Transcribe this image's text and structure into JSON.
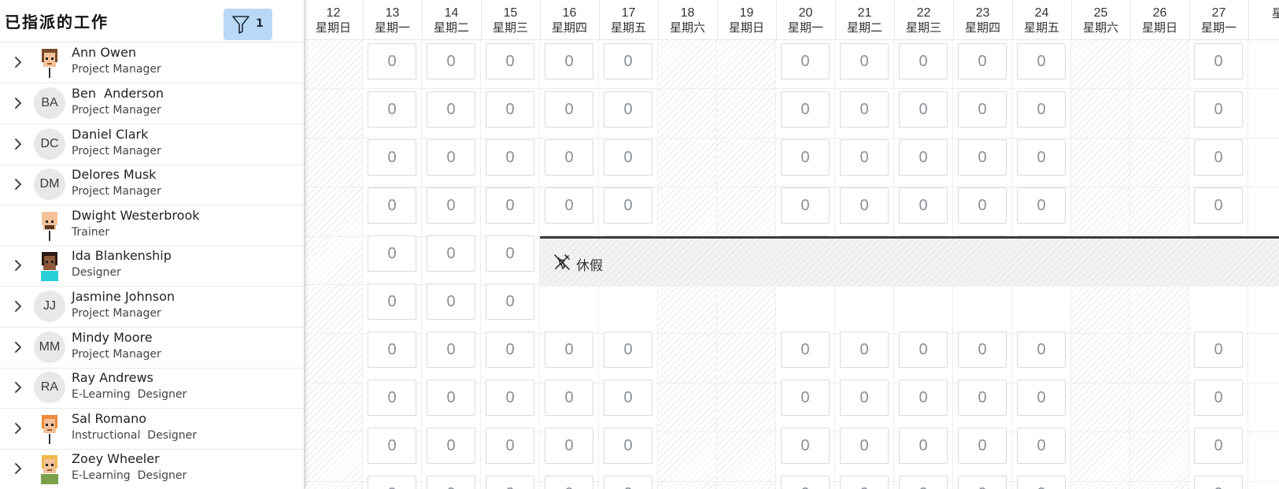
{
  "header": {
    "title": "已指派的工作",
    "filter_count": "1"
  },
  "dates": [
    {
      "num": "12",
      "day": "星期日",
      "weekend": true
    },
    {
      "num": "13",
      "day": "星期一",
      "weekend": false
    },
    {
      "num": "14",
      "day": "星期二",
      "weekend": false
    },
    {
      "num": "15",
      "day": "星期三",
      "weekend": false
    },
    {
      "num": "16",
      "day": "星期四",
      "weekend": false
    },
    {
      "num": "17",
      "day": "星期五",
      "weekend": false
    },
    {
      "num": "18",
      "day": "星期六",
      "weekend": true
    },
    {
      "num": "19",
      "day": "星期日",
      "weekend": true
    },
    {
      "num": "20",
      "day": "星期一",
      "weekend": false
    },
    {
      "num": "21",
      "day": "星期二",
      "weekend": false
    },
    {
      "num": "22",
      "day": "星期三",
      "weekend": false
    },
    {
      "num": "23",
      "day": "星期四",
      "weekend": false
    },
    {
      "num": "24",
      "day": "星期五",
      "weekend": false
    },
    {
      "num": "25",
      "day": "星期六",
      "weekend": true
    },
    {
      "num": "26",
      "day": "星期日",
      "weekend": true
    },
    {
      "num": "27",
      "day": "星期一",
      "weekend": false
    },
    {
      "num": "",
      "day": "星",
      "weekend": false
    }
  ],
  "people": [
    {
      "name": "Ann Owen",
      "role": "Project Manager",
      "initials": "",
      "avatar": "cartoon-woman-brown-hair",
      "expandable": true
    },
    {
      "name": "Ben  Anderson",
      "role": "Project Manager",
      "initials": "BA",
      "avatar": "initials",
      "expandable": true
    },
    {
      "name": "Daniel Clark",
      "role": "Project Manager",
      "initials": "DC",
      "avatar": "initials",
      "expandable": true
    },
    {
      "name": "Delores Musk",
      "role": "Project Manager",
      "initials": "DM",
      "avatar": "initials",
      "expandable": true
    },
    {
      "name": "Dwight Westerbrook",
      "role": "Trainer",
      "initials": "",
      "avatar": "cartoon-man-bald-beard",
      "expandable": false
    },
    {
      "name": "Ida Blankenship",
      "role": "Designer",
      "initials": "",
      "avatar": "cartoon-woman-dark-hair",
      "expandable": true
    },
    {
      "name": "Jasmine Johnson",
      "role": "Project Manager",
      "initials": "JJ",
      "avatar": "initials",
      "expandable": true
    },
    {
      "name": "Mindy Moore",
      "role": "Project Manager",
      "initials": "MM",
      "avatar": "initials",
      "expandable": true
    },
    {
      "name": "Ray Andrews",
      "role": "E-Learning  Designer",
      "initials": "RA",
      "avatar": "initials",
      "expandable": true
    },
    {
      "name": "Sal Romano",
      "role": "Instructional  Designer",
      "initials": "",
      "avatar": "cartoon-man-orange-hair",
      "expandable": true
    },
    {
      "name": "Zoey Wheeler",
      "role": "E-Learning  Designer",
      "initials": "",
      "avatar": "cartoon-woman-blonde-hair",
      "expandable": true
    }
  ],
  "cell_value": "0",
  "time_off": {
    "label": "休假",
    "icon": "airplane-off-icon",
    "person": "Ida Blankenship",
    "from_date": "16"
  },
  "colors": {
    "filter_bg": "#b8d8f5",
    "grid_line": "#eceef0"
  }
}
